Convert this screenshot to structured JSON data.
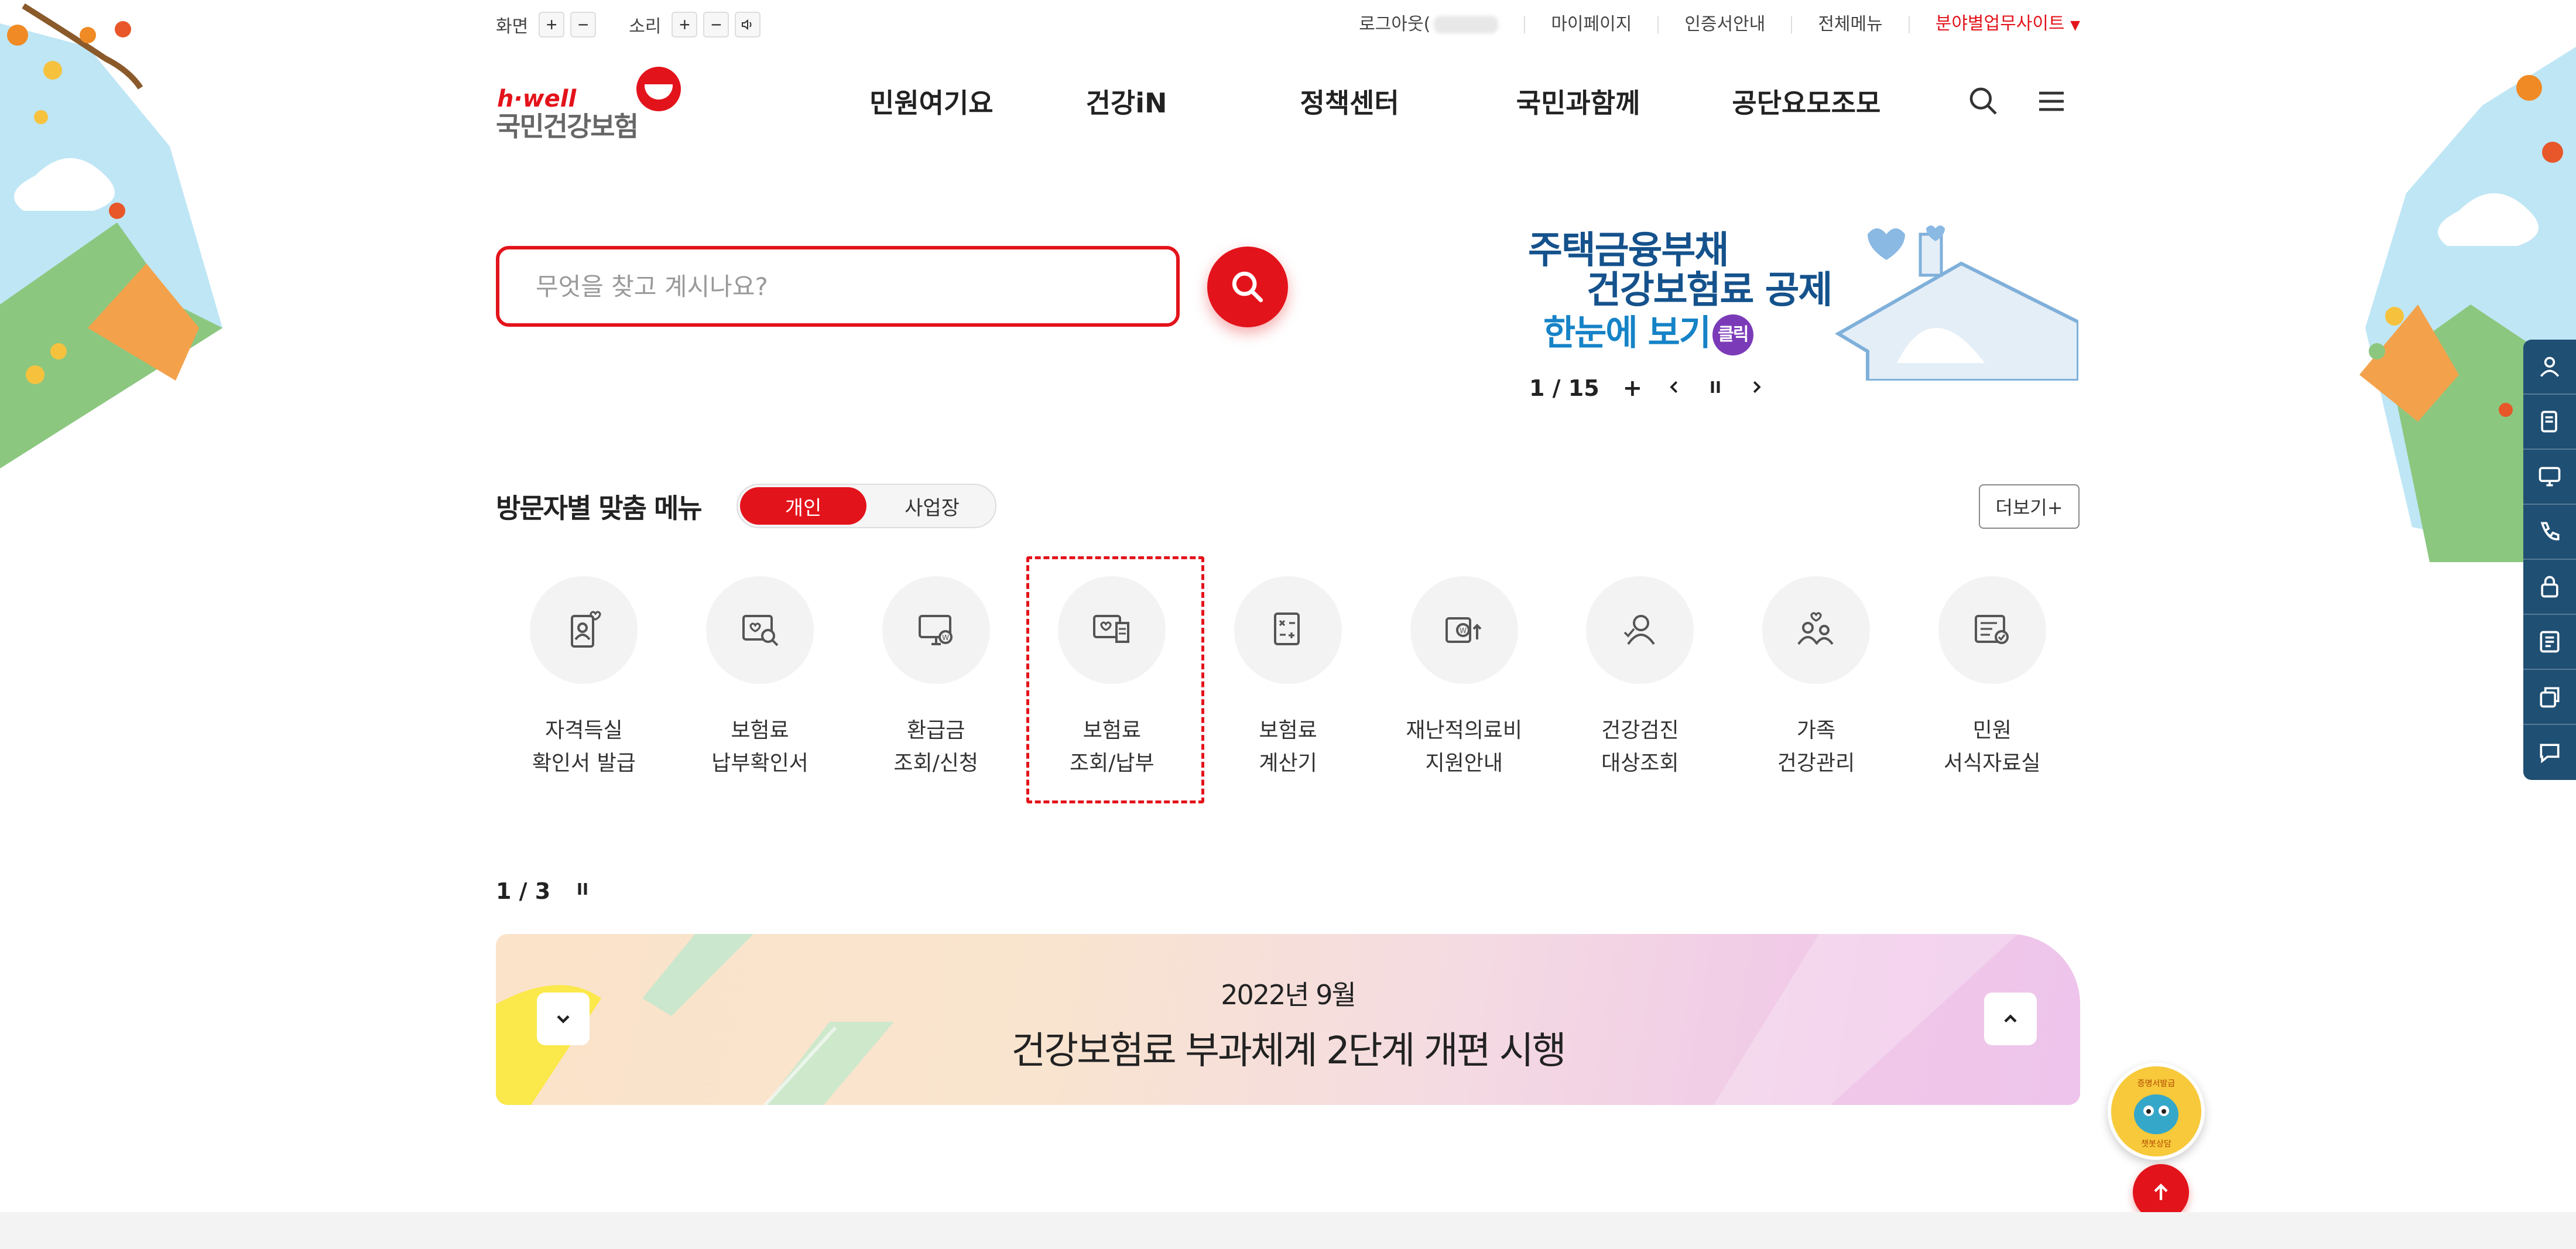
{
  "utility": {
    "screen_label": "화면",
    "sound_label": "소리",
    "logout": "로그아웃(",
    "mypage": "마이페이지",
    "cert": "인증서안내",
    "sitemap": "전체메뉴",
    "field_sites": "분야별업무사이트"
  },
  "logo": {
    "hwell": "h·well",
    "name": "국민건강보험"
  },
  "gnb": [
    "민원여기요",
    "건강iN",
    "정책센터",
    "국민과함께",
    "공단요모조모"
  ],
  "search": {
    "placeholder": "무엇을 찾고 계시나요?"
  },
  "banner": {
    "line1": "주택금융부채",
    "line2": "건강보험료 공제",
    "line3": "한눈에 보기",
    "click": "클릭",
    "counter": "1 / 15"
  },
  "custom_menu": {
    "title": "방문자별 맞춤 메뉴",
    "tabs": [
      "개인",
      "사업장"
    ],
    "more": "더보기+",
    "items": [
      {
        "label": "자격득실\n확인서 발급",
        "icon": "certificate-person-icon"
      },
      {
        "label": "보험료\n납부확인서",
        "icon": "payment-search-icon"
      },
      {
        "label": "환급금\n조회/신청",
        "icon": "refund-monitor-icon"
      },
      {
        "label": "보험료\n조회/납부",
        "icon": "premium-monitor-icon"
      },
      {
        "label": "보험료\n계산기",
        "icon": "calculator-icon"
      },
      {
        "label": "재난적의료비\n지원안내",
        "icon": "disaster-aid-icon"
      },
      {
        "label": "건강검진\n대상조회",
        "icon": "checkup-person-icon"
      },
      {
        "label": "가족\n건강관리",
        "icon": "family-care-icon"
      },
      {
        "label": "민원\n서식자료실",
        "icon": "form-archive-icon"
      }
    ]
  },
  "notice": {
    "counter": "1 / 3",
    "date": "2022년 9월",
    "title": "건강보험료 부과체계 2단계 개편 시행"
  },
  "chatbot": {
    "text_top": "증명서발급",
    "text_bottom": "챗봇상담"
  },
  "colors": {
    "brand_red": "#e3131b",
    "navy": "#1f4f73",
    "banner_blue": "#15528c"
  }
}
